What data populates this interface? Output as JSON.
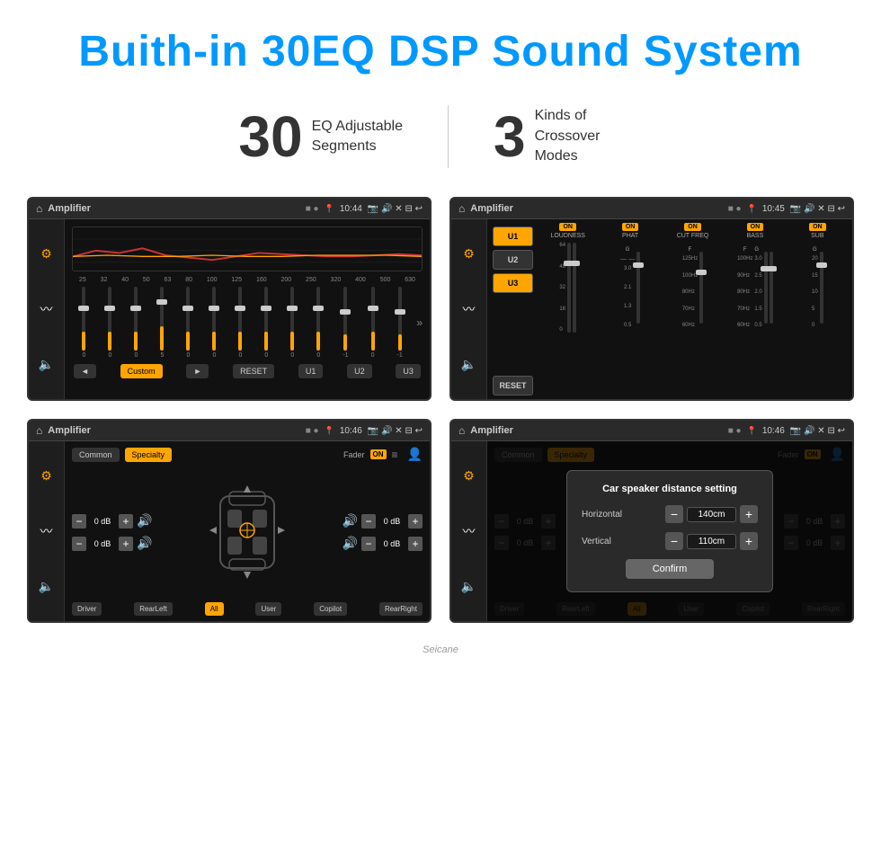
{
  "header": {
    "title": "Buith-in 30EQ DSP Sound System"
  },
  "stats": [
    {
      "number": "30",
      "label": "EQ Adjustable\nSegments"
    },
    {
      "number": "3",
      "label": "Kinds of\nCrossover Modes"
    }
  ],
  "screens": {
    "eq": {
      "title": "Amplifier",
      "time": "10:44",
      "frequencies": [
        "25",
        "32",
        "40",
        "50",
        "63",
        "80",
        "100",
        "125",
        "160",
        "200",
        "250",
        "320",
        "400",
        "500",
        "630"
      ],
      "sliders": [
        0,
        0,
        0,
        5,
        0,
        0,
        0,
        0,
        0,
        0,
        -1,
        0,
        -1
      ],
      "buttons": [
        "Custom",
        "RESET",
        "U1",
        "U2",
        "U3"
      ]
    },
    "crossover": {
      "title": "Amplifier",
      "time": "10:45",
      "modes": [
        "U1",
        "U2",
        "U3"
      ],
      "channels": [
        {
          "name": "LOUDNESS",
          "on": true
        },
        {
          "name": "PHAT",
          "on": true
        },
        {
          "name": "CUT FREQ",
          "on": true
        },
        {
          "name": "BASS",
          "on": true
        },
        {
          "name": "SUB",
          "on": true
        }
      ]
    },
    "specialty": {
      "title": "Amplifier",
      "time": "10:46",
      "tabs": [
        "Common",
        "Specialty"
      ],
      "fader_label": "Fader",
      "fader_on": "ON",
      "db_values": [
        "0 dB",
        "0 dB",
        "0 dB",
        "0 dB"
      ],
      "positions": [
        "Driver",
        "RearLeft",
        "All",
        "User",
        "Copilot",
        "RearRight"
      ]
    },
    "dialog": {
      "title": "Amplifier",
      "time": "10:46",
      "dialog": {
        "heading": "Car speaker distance setting",
        "horizontal_label": "Horizontal",
        "horizontal_value": "140cm",
        "vertical_label": "Vertical",
        "vertical_value": "110cm",
        "confirm_label": "Confirm"
      },
      "positions": [
        "Driver",
        "RearLeft",
        "All",
        "User",
        "Copilot",
        "RearRight"
      ]
    }
  },
  "watermark": "Seicane"
}
